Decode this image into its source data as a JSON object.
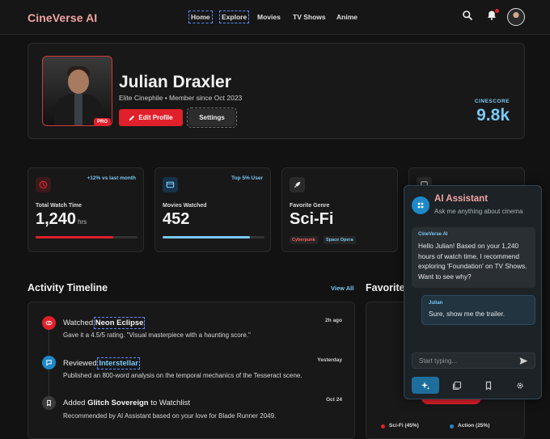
{
  "app": {
    "title": "CineVerse AI"
  },
  "nav": {
    "items": [
      "Home",
      "Explore",
      "Movies",
      "TV Shows",
      "Anime"
    ]
  },
  "profile": {
    "name": "Julian Draxler",
    "subtitle": "Elite Cinephile • Member since Oct 2023",
    "badge": "PRO",
    "edit_label": "Edit Profile",
    "settings_label": "Settings",
    "cinescore_label": "CINESCORE",
    "cinescore_value": "9.8k"
  },
  "stats": [
    {
      "label": "Total Watch Time",
      "value": "1,240",
      "unit": "hrs",
      "tag": "+12% vs last month",
      "progress": 0.76,
      "color": "#e0202a",
      "icon": "clock-icon"
    },
    {
      "label": "Movies Watched",
      "value": "452",
      "tag": "Top 5% User",
      "progress": 0.86,
      "color": "#7ac8f4",
      "icon": "film-icon"
    },
    {
      "label": "Favorite Genre",
      "value": "Sci-Fi",
      "chips": [
        "Cyberpunk",
        "Space Opera"
      ],
      "icon": "rocket-icon"
    }
  ],
  "activity": {
    "title": "Activity Timeline",
    "view_all": "View All",
    "items": [
      {
        "verb": "Watched",
        "target": "Neon Eclipse",
        "suffix": "",
        "time": "2h ago",
        "desc": "Gave it a 4.5/5 rating. \"Visual masterpiece with a haunting score.\""
      },
      {
        "verb": "Reviewed",
        "target": "Interstellar",
        "suffix": "",
        "time": "Yesterday",
        "desc": "Published an 800-word analysis on the temporal mechanics of the Tesseract scene."
      },
      {
        "verb": "Added",
        "target": "Glitch Sovereign",
        "suffix": "to Watchlist",
        "time": "Oct 24",
        "desc": "Recommended by AI Assistant based on your love for Blade Runner 2049."
      }
    ]
  },
  "favorites": {
    "title": "Favorite",
    "legend": [
      "Sci-Fi (45%)",
      "Action (25%)"
    ],
    "colors": [
      "#e0202a",
      "#1e88c8"
    ]
  },
  "assistant": {
    "title": "AI Assistant",
    "subtitle": "Ask me anything about cinema",
    "bot_name": "CineVerse AI",
    "bot_message": "Hello Julian! Based on your 1,240 hours of watch time, I recommend exploring 'Foundation' on TV Shows. Want to see why?",
    "user_name": "Julian",
    "user_message": "Sure, show me the trailer.",
    "input_placeholder": "Start typing..."
  }
}
